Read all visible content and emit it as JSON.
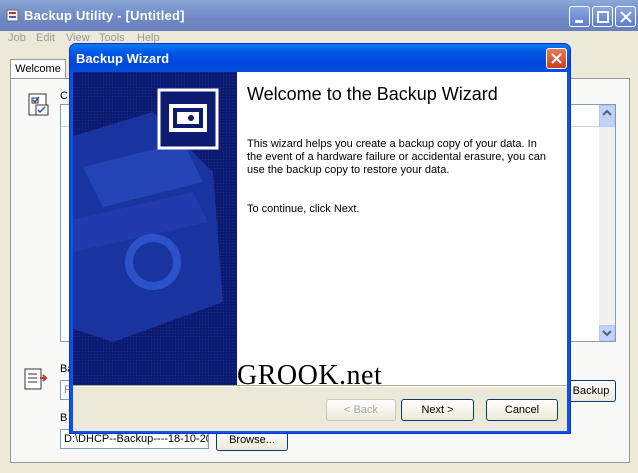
{
  "main_window": {
    "title": "Backup Utility - [Untitled]",
    "menu": [
      "Job",
      "Edit",
      "View",
      "Tools",
      "Help"
    ],
    "tab_label": "Welcome",
    "partial_label_1": "C",
    "partial_label_2": "Ba",
    "partial_label_3": "B",
    "partial_input": "F",
    "backup_file_path": "D:\\DHCP--Backup----18-10-20",
    "browse_label": "Browse...",
    "backup_button_label": "Backup"
  },
  "wizard": {
    "title": "Backup Wizard",
    "heading": "Welcome to the Backup Wizard",
    "paragraph": "This wizard helps you create a backup copy of your data. In the event of a hardware failure or accidental erasure, you can use the backup copy to restore your data.",
    "continue_text": "To continue, click Next.",
    "back_label": "< Back",
    "next_label": "Next >",
    "cancel_label": "Cancel"
  },
  "watermark": "GROOK.net",
  "colors": {
    "titlebar_inactive": "#7f9bd0",
    "dialog_titlebar": "#0058e6",
    "wizard_art": "#0c1a6f",
    "close_button": "#c6401c"
  }
}
